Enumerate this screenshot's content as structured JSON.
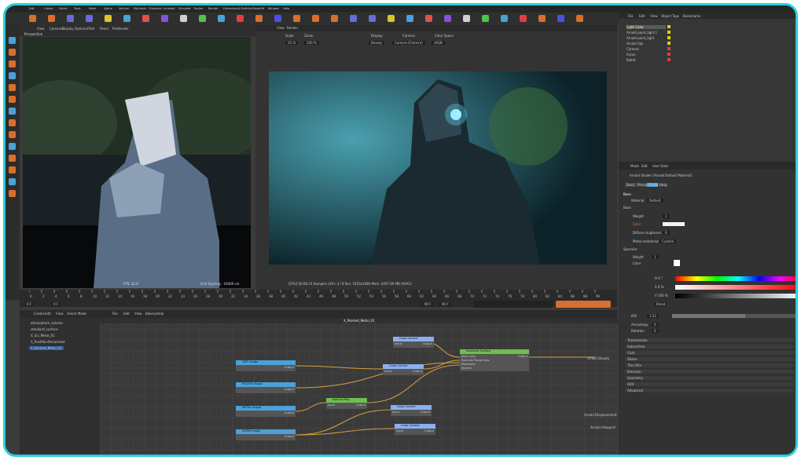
{
  "menubar": {
    "items": [
      "Edit",
      "Create",
      "Select",
      "Tools",
      "Mesh",
      "Spline",
      "Volume",
      "MoGraph",
      "Character",
      "Animate",
      "Simulate",
      "Tracker",
      "Render",
      "Extensions",
      "X-Particles",
      "Redshift",
      "Window",
      "Help"
    ]
  },
  "viewport": {
    "menu": [
      "View",
      "Cameras",
      "Display",
      "Options",
      "Filter",
      "Panel",
      "ProRender"
    ],
    "label": "Perspective",
    "fps": "FPS: 32.6",
    "grid": "Grid Spacing : 10000 cm"
  },
  "render_view": {
    "menu": [
      "View",
      "Render"
    ],
    "scale_label": "Scale",
    "scale": "25 %",
    "zoom_label": "Zoom",
    "zoom": "100 %",
    "display_label": "Display",
    "display": "Beauty",
    "camera_label": "Camera",
    "camera": "Camera (Camera)",
    "colorspace_label": "Color Space",
    "colorspace": "sRGB",
    "status": "[CPU] 00:00:31  Samples (AA): 3 / 9  Res: 1920x1080  Mem: 4497.69 MB  (AVX2)"
  },
  "timeline": {
    "ticks": [
      "0",
      "2",
      "4",
      "6",
      "8",
      "10",
      "12",
      "14",
      "16",
      "18",
      "20",
      "22",
      "24",
      "26",
      "28",
      "30",
      "32",
      "34",
      "36",
      "38",
      "40",
      "42",
      "44",
      "46",
      "48",
      "50",
      "52",
      "54",
      "56",
      "58",
      "60",
      "62",
      "64",
      "66",
      "68",
      "70",
      "72",
      "74",
      "76",
      "78",
      "80",
      "82",
      "84",
      "86",
      "88",
      "90"
    ],
    "start": "0 F",
    "current": "0 F",
    "end": "90 F",
    "end2": "90 F"
  },
  "node_editor": {
    "menu": [
      "Create",
      "Edit",
      "View",
      "Select",
      "Mode",
      "File",
      "Edit",
      "View",
      "Bakery",
      "Help"
    ],
    "title": "X_Painted_Metal_01",
    "list": [
      "atmosphere_volume",
      "standard_surface",
      "X_Sci_Metal_01",
      "X_RustPaintScratched",
      "X_Painted_Metal_01"
    ],
    "nodes": [
      {
        "label": "DIFF image",
        "out": "Output"
      },
      {
        "label": "ROUGH image",
        "out": "Output"
      },
      {
        "label": "METAL image",
        "out": "Output"
      },
      {
        "label": "NORM image",
        "out": "Output"
      },
      {
        "label": "Color Correct",
        "in": "Input",
        "out": "Output"
      },
      {
        "label": "Color Correct",
        "in": "Input",
        "out": "Output"
      },
      {
        "label": "Color Correct",
        "in": "Input",
        "out": "Output"
      },
      {
        "label": "Color Correct",
        "in": "Input",
        "out": "Output"
      },
      {
        "label": "Normal Map",
        "in": "Input",
        "out": "Output"
      },
      {
        "label": "Standard Surface",
        "rows": [
          "Base Color",
          "Specular Roughness",
          "Metalness",
          "Normal"
        ],
        "out": "Output"
      }
    ],
    "outputs": [
      "Arnold Beauty",
      "Arnold Displacement",
      "Arnold Viewport"
    ]
  },
  "objects": {
    "menu": [
      "File",
      "Edit",
      "View",
      "Object",
      "Tags",
      "Bookmarks"
    ],
    "items": [
      "Light Color",
      "Arnold point_light.1",
      "Arnold point_light",
      "Arnold Sky",
      "Camera",
      "Focus",
      "Robot"
    ]
  },
  "attributes": {
    "menu": [
      "Mode",
      "Edit",
      "User Data"
    ],
    "title": "Arnold Shader [Arnold Default Material]",
    "tabs": [
      "Basic",
      "Preview",
      "Shader",
      "Help"
    ],
    "section": "Base",
    "material_label": "Material",
    "material": "Default",
    "base": [
      "Base",
      "Weight",
      "Color",
      "Diffuse roughness",
      "Metal metalness"
    ],
    "weight": "1",
    "diffuse_rough": "0",
    "metalness_mode": "Custom",
    "specular": [
      "Specular",
      "Weight",
      "Color"
    ],
    "spec_weight": "1",
    "h": "H  0 °",
    "s": "S  0 %",
    "v": "V  100 %",
    "iblend": "Blend",
    "ior_label": "IOR",
    "ior": "1.52",
    "anisotropy_label": "Anisotropy",
    "anisotropy": "0",
    "rotation_label": "Rotation",
    "rotation": "0",
    "groups": [
      "Transmission",
      "Subsurface",
      "Coat",
      "Sheen",
      "Thin Film",
      "Emission",
      "Geometry",
      "AOV",
      "Advanced"
    ]
  },
  "colors": {
    "accent": "#24d0e0",
    "node_blue": "#4aa2d8",
    "node_green": "#6ebe50",
    "node_orange": "#e07a30",
    "wire": "#d7a040"
  }
}
